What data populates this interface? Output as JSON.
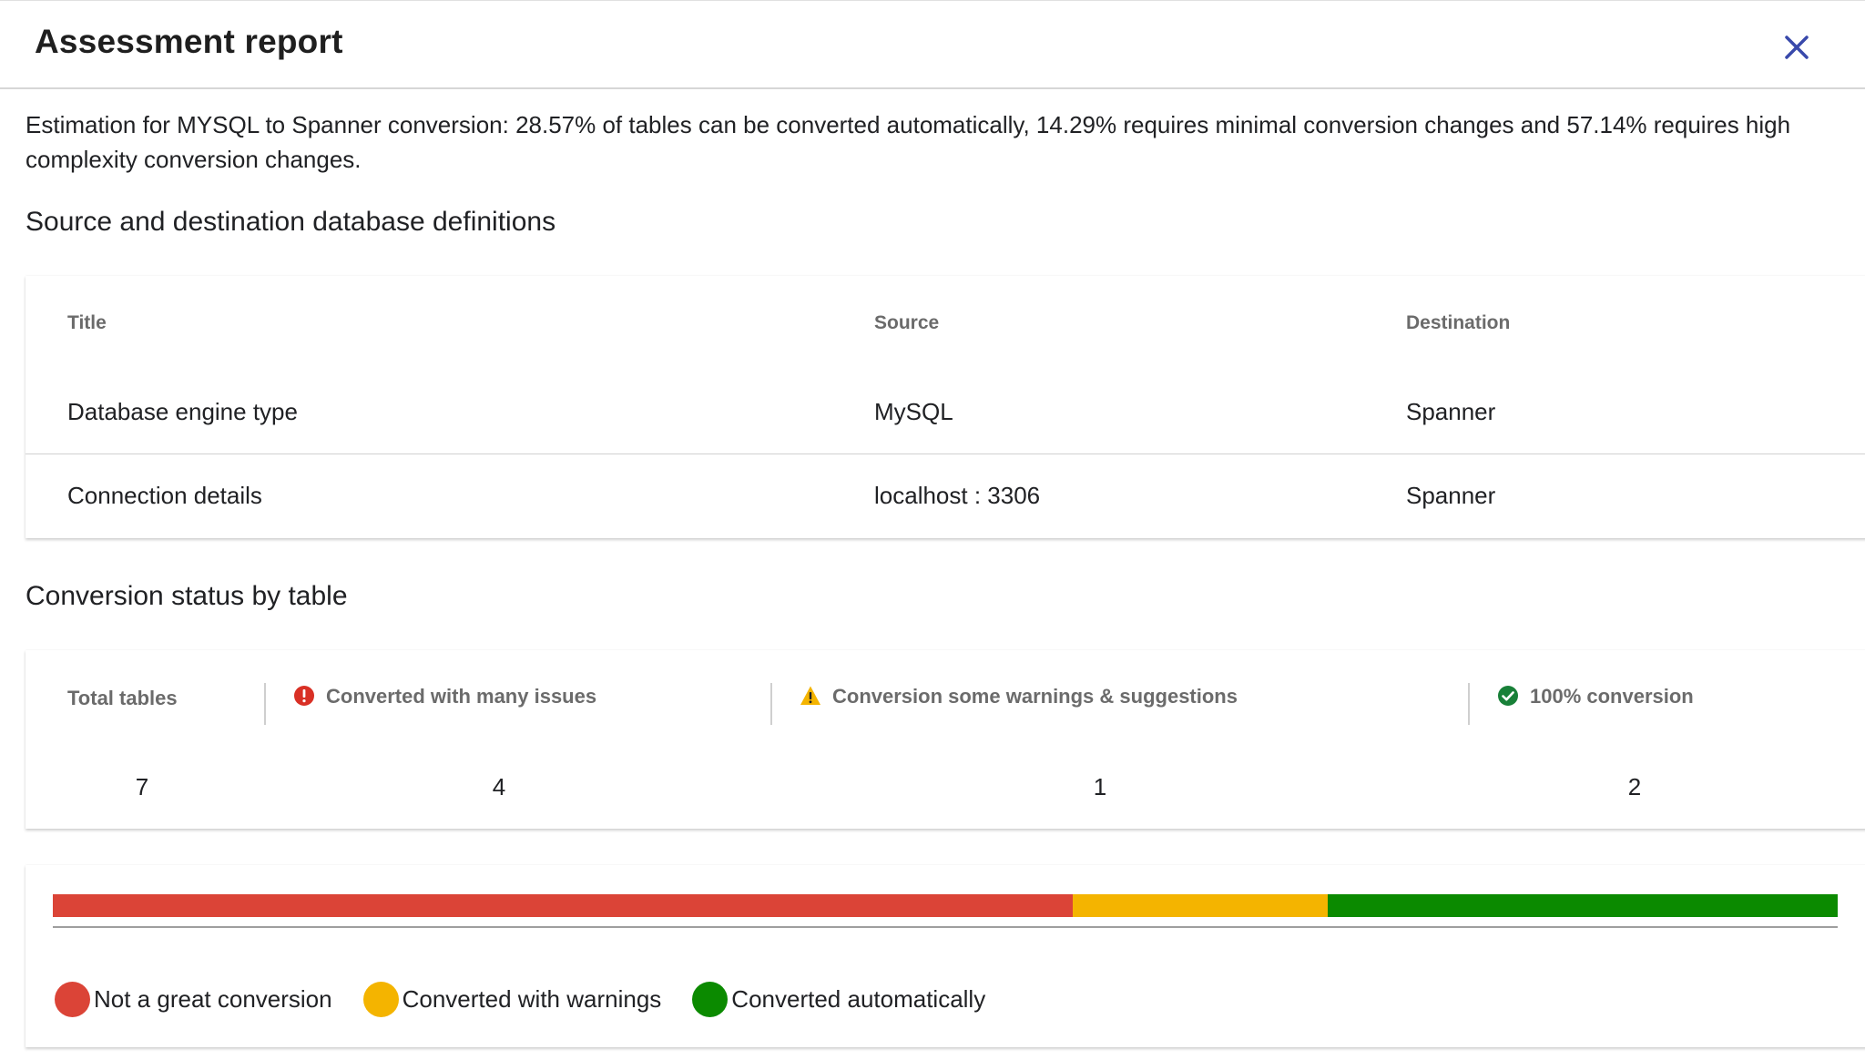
{
  "dialog": {
    "title": "Assessment report",
    "close_icon": "close-icon"
  },
  "summary": {
    "text": "Estimation for MYSQL to Spanner conversion: 28.57% of tables can be converted automatically, 14.29% requires minimal conversion changes and 57.14% requires high complexity conversion changes."
  },
  "definitions": {
    "heading": "Source and destination database definitions",
    "columns": [
      "Title",
      "Source",
      "Destination"
    ],
    "rows": [
      [
        "Database engine type",
        "MySQL",
        "Spanner"
      ],
      [
        "Connection details",
        "localhost : 3306",
        "Spanner"
      ]
    ]
  },
  "conversion": {
    "heading": "Conversion status by table",
    "stats": [
      {
        "label": "Total tables",
        "value": "7",
        "icon": ""
      },
      {
        "label": "Converted with many issues",
        "value": "4",
        "icon": "error-icon"
      },
      {
        "label": "Conversion some warnings & suggestions",
        "value": "1",
        "icon": "warning-icon"
      },
      {
        "label": "100% conversion",
        "value": "2",
        "icon": "check-circle-icon"
      }
    ]
  },
  "progress": {
    "segments": [
      {
        "name": "Not a great conversion",
        "fraction": 0.5714,
        "color": "#db4437"
      },
      {
        "name": "Converted with warnings",
        "fraction": 0.1429,
        "color": "#f4b400"
      },
      {
        "name": "Converted automatically",
        "fraction": 0.2857,
        "color": "#0b8a00"
      }
    ]
  },
  "legend": {
    "items": [
      {
        "label": "Not a great conversion",
        "color": "#db4437"
      },
      {
        "label": "Converted with warnings",
        "color": "#f4b400"
      },
      {
        "label": "Converted automatically",
        "color": "#0b8a00"
      }
    ]
  },
  "colors": {
    "accent": "#3949ab",
    "error": "#d93025",
    "warning": "#f4b400",
    "success": "#188038"
  }
}
